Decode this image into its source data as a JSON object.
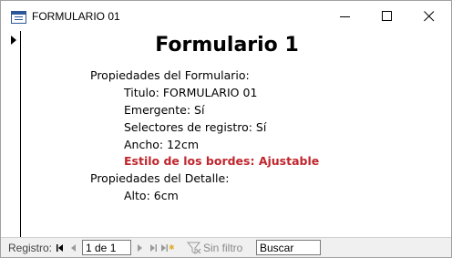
{
  "window": {
    "title": "FORMULARIO 01",
    "app_icon": "access-form-icon",
    "controls": {
      "minimize": "minimize-icon",
      "maximize": "maximize-icon",
      "close": "close-icon"
    }
  },
  "form": {
    "title": "Formulario 1",
    "lines": [
      "Propiedades del Formulario:",
      "Titulo: FORMULARIO 01",
      "Emergente: Sí",
      "Selectores de registro: Sí",
      "Ancho: 12cm",
      "Estilo de los bordes: Ajustable",
      "Propiedades del Detalle:",
      "Alto: 6cm"
    ],
    "highlight_color": "#c0262d"
  },
  "navigation": {
    "label": "Registro:",
    "record_position": "1 de 1",
    "filter_label": "Sin filtro",
    "search_placeholder": "Buscar",
    "icons": [
      "first-record-icon",
      "previous-record-icon",
      "next-record-icon",
      "last-record-icon",
      "new-record-icon",
      "filter-icon"
    ]
  }
}
